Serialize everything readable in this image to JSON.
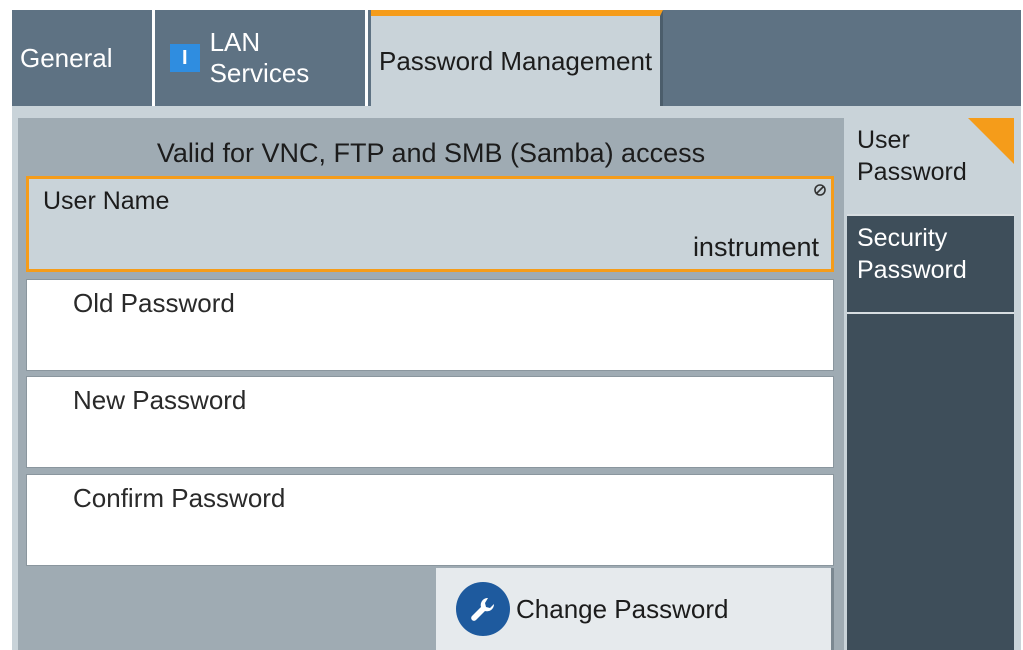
{
  "tabs": [
    {
      "label": "General"
    },
    {
      "label": "LAN Services",
      "icon": "info-icon"
    },
    {
      "label": "Password Management",
      "active": true
    }
  ],
  "main": {
    "header": "Valid for VNC, FTP and SMB (Samba) access",
    "fields": [
      {
        "label": "User Name",
        "value": "instrument",
        "icon": "lock-icon"
      },
      {
        "label": "Old Password",
        "value": ""
      },
      {
        "label": "New Password",
        "value": ""
      },
      {
        "label": "Confirm Password",
        "value": ""
      }
    ],
    "button": {
      "label": "Change Password",
      "icon": "wrench-icon"
    }
  },
  "side_tabs": [
    {
      "label": "User Password",
      "active": true
    },
    {
      "label": "Security Password"
    }
  ],
  "colors": {
    "accent": "#f59c1a",
    "tab_bg": "#5e7283",
    "active_bg": "#c9d3d9",
    "side_dark": "#3e4e5a"
  }
}
